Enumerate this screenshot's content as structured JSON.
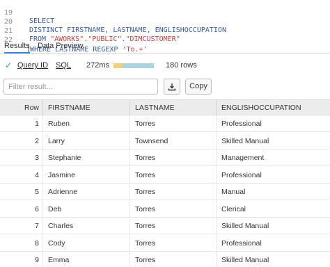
{
  "editor": {
    "lines": [
      {
        "num": "19",
        "text": "SELECT"
      },
      {
        "num": "20",
        "text": "DISTINCT FIRSTNAME, LASTNAME, ENGLISHOCCUPATION"
      },
      {
        "num": "21",
        "pre": "FROM ",
        "str": "\"AWORKS\".\"PUBLIC\".\"DIMCUSTOMER\"",
        "post": ""
      },
      {
        "num": "22",
        "pre": "WHERE LASTNAME REGEXP ",
        "str": "'To.+'",
        "post": ""
      }
    ]
  },
  "tabs": [
    {
      "label": "Results",
      "active": true
    },
    {
      "label": "Data Preview",
      "active": false
    }
  ],
  "status": {
    "query_id": "Query ID",
    "sql": "SQL",
    "time": "272ms",
    "progress_compile_fraction": 0.22,
    "rows": "180 rows"
  },
  "filter": {
    "placeholder": "Filter result...",
    "value": ""
  },
  "buttons": {
    "copy": "Copy",
    "download_icon": "download-icon"
  },
  "colors": {
    "accent": "#3b7dd8",
    "success": "#3aa655",
    "bar_main": "#a9d4e0",
    "bar_compile": "#f2cf7a",
    "string": "#c3423f",
    "keyword": "#3b5ba5"
  },
  "table": {
    "columns": [
      "Row",
      "FIRSTNAME",
      "LASTNAME",
      "ENGLISHOCCUPATION"
    ],
    "rows": [
      [
        "1",
        "Ruben",
        "Torres",
        "Professional"
      ],
      [
        "2",
        "Larry",
        "Townsend",
        "Skilled Manual"
      ],
      [
        "3",
        "Stephanie",
        "Torres",
        "Management"
      ],
      [
        "4",
        "Jasmine",
        "Torres",
        "Professional"
      ],
      [
        "5",
        "Adrienne",
        "Torres",
        "Manual"
      ],
      [
        "6",
        "Deb",
        "Torres",
        "Clerical"
      ],
      [
        "7",
        "Charles",
        "Torres",
        "Skilled Manual"
      ],
      [
        "8",
        "Cody",
        "Torres",
        "Professional"
      ],
      [
        "9",
        "Emma",
        "Torres",
        "Skilled Manual"
      ]
    ]
  }
}
